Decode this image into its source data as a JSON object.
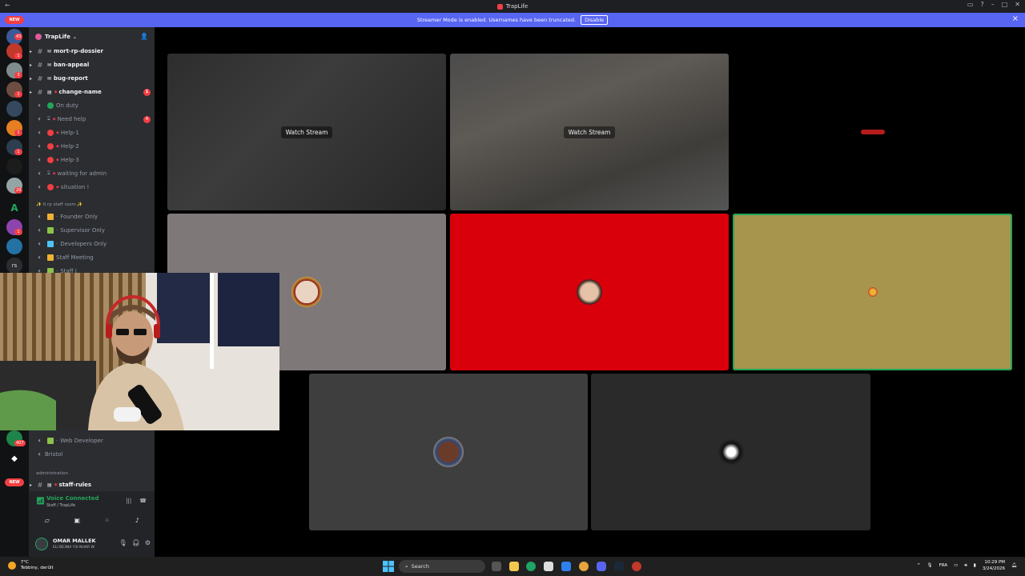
{
  "window": {
    "title": "TrapLife"
  },
  "banner": {
    "text": "Streamer Mode is enabled. Usernames have been truncated.",
    "disable_label": "Disable"
  },
  "rail": {
    "new_top": "NEW",
    "new_bottom": "NEW",
    "mentions": [
      "43",
      "1",
      "3",
      "1",
      "1",
      "1",
      "29",
      "1",
      "407"
    ],
    "rs_label": "rs",
    "a_label": "A"
  },
  "guild": {
    "name": "TrapLife"
  },
  "channels": [
    {
      "name": "mort-rp-dossier",
      "kind": "text",
      "bold": true
    },
    {
      "name": "ban-appeal",
      "kind": "text",
      "bold": true
    },
    {
      "name": "bug-report",
      "kind": "text",
      "bold": true
    },
    {
      "name": "change-name",
      "kind": "text",
      "bold": true,
      "badge": "1"
    },
    {
      "name": "On duty",
      "kind": "voice"
    },
    {
      "name": "Need help",
      "kind": "voice",
      "badge": "4"
    },
    {
      "name": "Help-1",
      "kind": "voice"
    },
    {
      "name": "Help-2",
      "kind": "voice"
    },
    {
      "name": "Help-3",
      "kind": "voice"
    },
    {
      "name": "waiting for admin",
      "kind": "voice"
    },
    {
      "name": "situation !",
      "kind": "voice"
    }
  ],
  "category_staff": "✨ tl rp staff room ✨",
  "staff_channels": [
    {
      "name": "Founder Only"
    },
    {
      "name": "Supervisor Only"
    },
    {
      "name": "Developers Only"
    },
    {
      "name": "Staff Meeting"
    },
    {
      "name": "Staff I"
    }
  ],
  "lower_channels": [
    {
      "name": "Web Developer"
    },
    {
      "name": "Bristol"
    }
  ],
  "category_admin": "administration",
  "admin_channels": [
    {
      "name": "staff-rules"
    }
  ],
  "voice": {
    "status": "Voice Connected",
    "location": "Staff / TrapLife"
  },
  "user": {
    "name": "OMAR MALLEK",
    "status": "ELI BE3NA Y3I NHAR W"
  },
  "stage": {
    "watch_label": "Watch Stream"
  },
  "taskbar": {
    "weather_temp": "7°C",
    "weather_desc": "Tebbiny, derûlt",
    "search": "Search",
    "lang": "FRA",
    "time": "10:29 PM",
    "date": "3/24/2026"
  },
  "colors": {
    "accent": "#5865f2",
    "speaking": "#23a55a",
    "mention": "#f23f43",
    "tile_red": "#d9000b",
    "tile_olive": "#a8954d",
    "tile_gray": "#7f7878"
  }
}
